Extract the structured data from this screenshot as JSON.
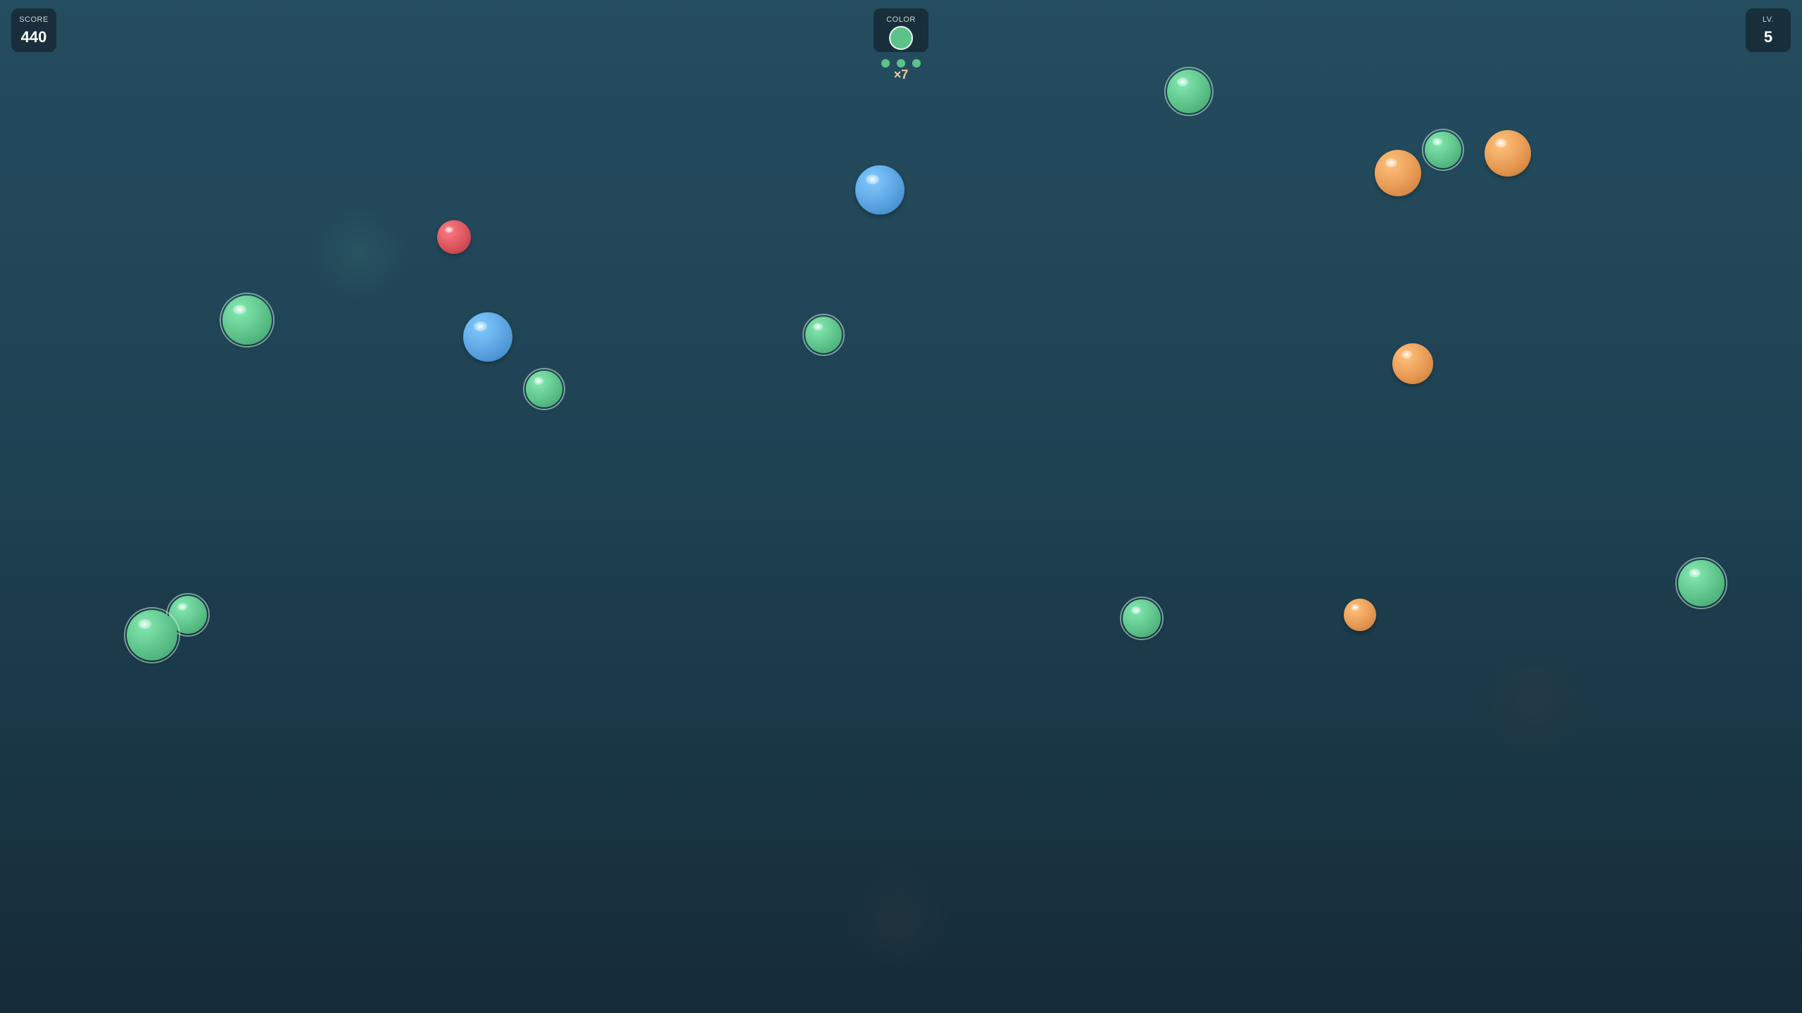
{
  "hud": {
    "score_label": "SCORE",
    "score_value": "440",
    "color_label": "COLOR",
    "level_label": "LV.",
    "level_value": "5",
    "combo_text": "×7"
  },
  "colors": {
    "green": "#5cc28a",
    "blue": "#5aa3e0",
    "orange": "#e79a54",
    "red": "#d9545c",
    "target": "green",
    "combo_dot": "#5cc28a"
  },
  "combo_dots": [
    "green",
    "green",
    "green"
  ],
  "bubbles": [
    {
      "color": "green",
      "target": true
    },
    {
      "color": "orange",
      "target": false
    },
    {
      "color": "green",
      "target": true
    },
    {
      "color": "orange",
      "target": false
    },
    {
      "color": "blue",
      "target": false
    },
    {
      "color": "red",
      "target": false
    },
    {
      "color": "green",
      "target": true
    },
    {
      "color": "blue",
      "target": false
    },
    {
      "color": "green",
      "target": true
    },
    {
      "color": "green",
      "target": true
    },
    {
      "color": "orange",
      "target": false
    },
    {
      "color": "green",
      "target": true
    },
    {
      "color": "green",
      "target": true
    },
    {
      "color": "green",
      "target": true
    },
    {
      "color": "orange",
      "target": false
    },
    {
      "color": "green",
      "target": true
    }
  ]
}
